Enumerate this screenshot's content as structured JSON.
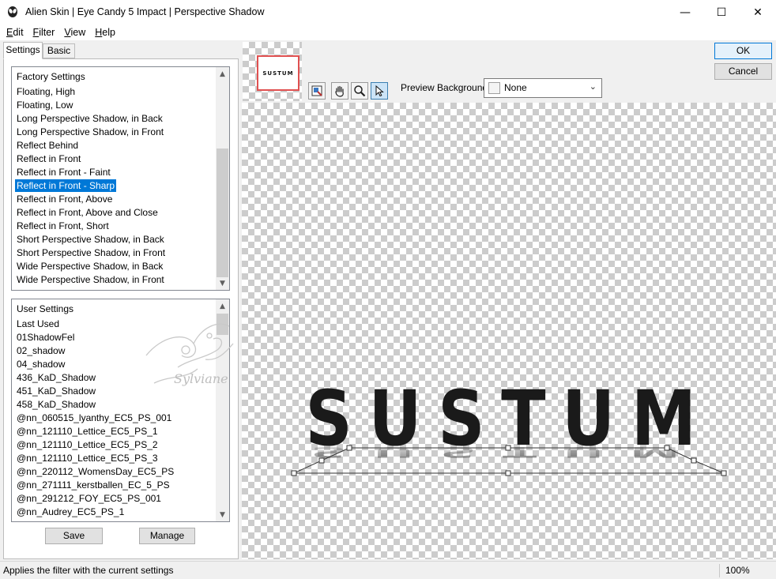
{
  "window": {
    "title": "Alien Skin | Eye Candy 5 Impact | Perspective Shadow",
    "minimize_glyph": "—",
    "maximize_glyph": "☐",
    "close_glyph": "✕"
  },
  "menu": {
    "items": [
      {
        "underline": "E",
        "rest": "dit"
      },
      {
        "underline": "F",
        "rest": "ilter"
      },
      {
        "underline": "V",
        "rest": "iew"
      },
      {
        "underline": "H",
        "rest": "elp"
      }
    ]
  },
  "tabs": [
    {
      "label": "Settings",
      "active": true
    },
    {
      "label": "Basic",
      "active": false
    }
  ],
  "factory_settings": {
    "header": "Factory Settings",
    "items": [
      "Floating, High",
      "Floating, Low",
      "Long Perspective Shadow, in Back",
      "Long Perspective Shadow, in Front",
      "Reflect Behind",
      "Reflect in Front",
      "Reflect in Front - Faint",
      "Reflect in Front - Sharp",
      "Reflect in Front, Above",
      "Reflect in Front, Above and Close",
      "Reflect in Front, Short",
      "Short Perspective Shadow, in Back",
      "Short Perspective Shadow, in Front",
      "Wide Perspective Shadow, in Back",
      "Wide Perspective Shadow, in Front"
    ],
    "selected_index": 7
  },
  "user_settings": {
    "header": "User Settings",
    "items": [
      "Last Used",
      "01ShadowFel",
      "02_shadow",
      "04_shadow",
      "436_KaD_Shadow",
      "451_KaD_Shadow",
      "458_KaD_Shadow",
      "@nn_060515_lyanthy_EC5_PS_001",
      "@nn_121110_Lettice_EC5_PS_1",
      "@nn_121110_Lettice_EC5_PS_2",
      "@nn_121110_Lettice_EC5_PS_3",
      "@nn_220112_WomensDay_EC5_PS",
      "@nn_271111_kerstballen_EC_5_PS",
      "@nn_291212_FOY_EC5_PS_001",
      "@nn_Audrey_EC5_PS_1"
    ]
  },
  "watermark_text": "Sylviane",
  "buttons": {
    "save": "Save",
    "manage": "Manage",
    "ok": "OK",
    "cancel": "Cancel"
  },
  "preview": {
    "thumbnail_text": "SUSTUM",
    "background_label": "Preview Background:",
    "background_value": "None",
    "canvas_text": "SUSTUM",
    "tools": [
      "navigator-icon",
      "hand-icon",
      "zoom-icon",
      "pointer-icon"
    ]
  },
  "status": {
    "text": "Applies the filter with the current settings",
    "zoom": "100%"
  }
}
